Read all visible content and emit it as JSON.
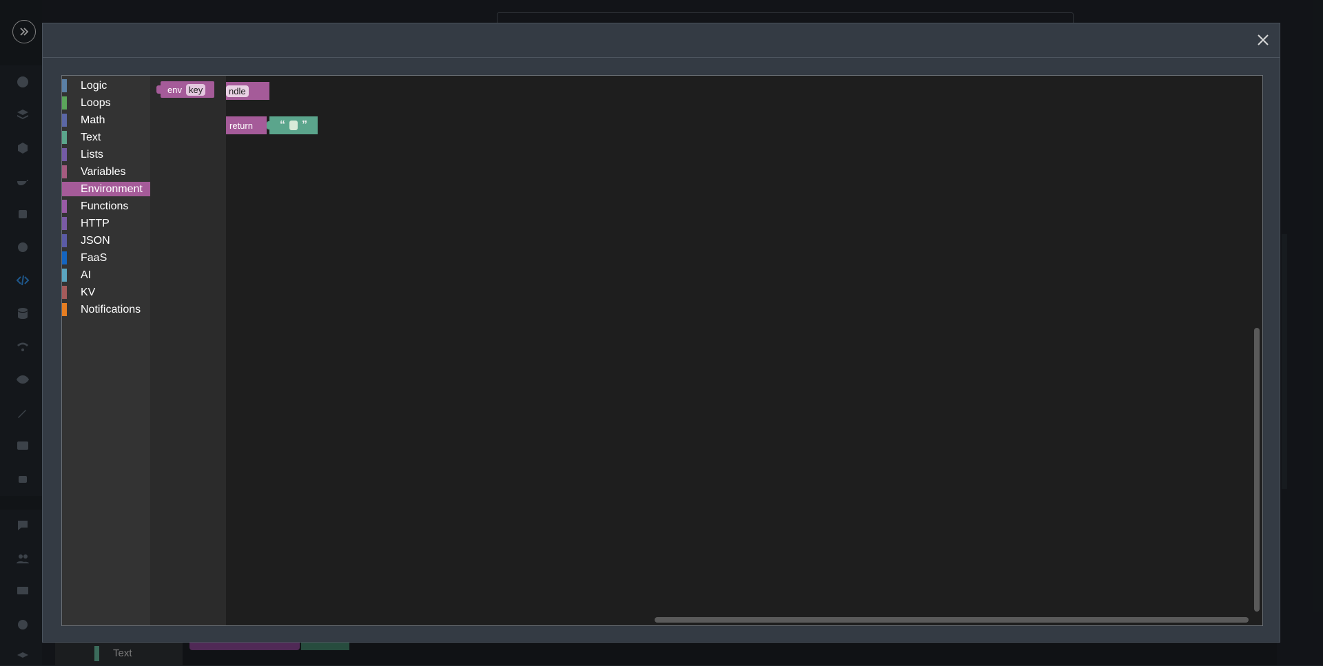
{
  "modal": {
    "close_icon": "close-icon"
  },
  "toolbox": {
    "categories": [
      {
        "label": "Logic",
        "color": "#5b80a5"
      },
      {
        "label": "Loops",
        "color": "#5ba55b"
      },
      {
        "label": "Math",
        "color": "#5b67a5"
      },
      {
        "label": "Text",
        "color": "#5ba58c"
      },
      {
        "label": "Lists",
        "color": "#745ba5"
      },
      {
        "label": "Variables",
        "color": "#a55b80"
      },
      {
        "label": "Environment",
        "color": "#a55b99",
        "selected": true
      },
      {
        "label": "Functions",
        "color": "#995ba5"
      },
      {
        "label": "HTTP",
        "color": "#7a5ba5"
      },
      {
        "label": "JSON",
        "color": "#5b5ba5"
      },
      {
        "label": "FaaS",
        "color": "#1565c0"
      },
      {
        "label": "AI",
        "color": "#5ba5c0"
      },
      {
        "label": "KV",
        "color": "#a55b5b"
      },
      {
        "label": "Notifications",
        "color": "#e67e22"
      }
    ]
  },
  "flyout": {
    "env_block": {
      "label": "env",
      "field": "key"
    }
  },
  "workspace": {
    "handler_block": {
      "text": "ndle"
    },
    "return_block": {
      "label": "return",
      "open_quote": "“",
      "close_quote": "”"
    }
  },
  "background": {
    "bottom_category": "Text"
  }
}
